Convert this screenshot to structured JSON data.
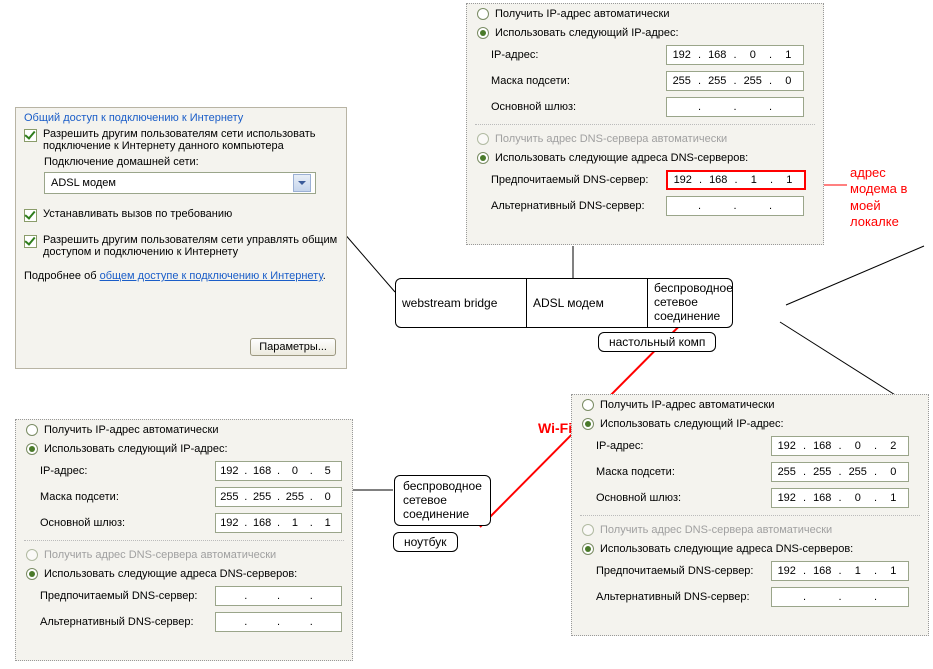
{
  "ics": {
    "title": "Общий доступ к подключению к Интернету",
    "allow_share": "Разрешить другим пользователям сети использовать подключение к Интернету данного компьютера",
    "home_conn_label": "Подключение домашней сети:",
    "home_conn_value": "ADSL модем",
    "dial_on_demand": "Устанавливать вызов по требованию",
    "allow_control": "Разрешить другим пользователям сети управлять общим доступом и подключению к Интернету",
    "learn_prefix": "Подробнее об ",
    "learn_link": "общем доступе к подключению к Интернету",
    "params_btn": "Параметры..."
  },
  "labels": {
    "auto_ip": "Получить IP-адрес автоматически",
    "use_ip": "Использовать следующий IP-адрес:",
    "ip": "IP-адрес:",
    "mask": "Маска подсети:",
    "gateway": "Основной шлюз:",
    "auto_dns": "Получить адрес DNS-сервера автоматически",
    "use_dns": "Использовать следующие адреса DNS-серверов:",
    "dns1": "Предпочитаемый DNS-сервер:",
    "dns2": "Альтернативный DNS-сервер:"
  },
  "p_top": {
    "ip": {
      "a": "192",
      "b": "168",
      "c": "0",
      "d": "1"
    },
    "mask": {
      "a": "255",
      "b": "255",
      "c": "255",
      "d": "0"
    },
    "gateway": {
      "a": "",
      "b": "",
      "c": "",
      "d": ""
    },
    "dns1": {
      "a": "192",
      "b": "168",
      "c": "1",
      "d": "1"
    },
    "dns2": {
      "a": "",
      "b": "",
      "c": "",
      "d": ""
    }
  },
  "p_right": {
    "ip": {
      "a": "192",
      "b": "168",
      "c": "0",
      "d": "2"
    },
    "mask": {
      "a": "255",
      "b": "255",
      "c": "255",
      "d": "0"
    },
    "gateway": {
      "a": "192",
      "b": "168",
      "c": "0",
      "d": "1"
    },
    "dns1": {
      "a": "192",
      "b": "168",
      "c": "1",
      "d": "1"
    },
    "dns2": {
      "a": "",
      "b": "",
      "c": "",
      "d": ""
    }
  },
  "p_left": {
    "ip": {
      "a": "192",
      "b": "168",
      "c": "0",
      "d": "5"
    },
    "mask": {
      "a": "255",
      "b": "255",
      "c": "255",
      "d": "0"
    },
    "gateway": {
      "a": "192",
      "b": "168",
      "c": "1",
      "d": "1"
    },
    "dns1": {
      "a": "",
      "b": "",
      "c": "",
      "d": ""
    },
    "dns2": {
      "a": "",
      "b": "",
      "c": "",
      "d": ""
    }
  },
  "nodes": {
    "webstream": "webstream bridge",
    "adsl": "ADSL модем",
    "wireless": "беспроводное\nсетевое\nсоединение",
    "desktop": "настольный комп",
    "laptop": "ноутбук",
    "laptop_wireless": "беспроводное\nсетевое\nсоединение"
  },
  "wifi": "Wi-Fi",
  "annot": "адрес\nмодема в\nмоей\nлокалке"
}
